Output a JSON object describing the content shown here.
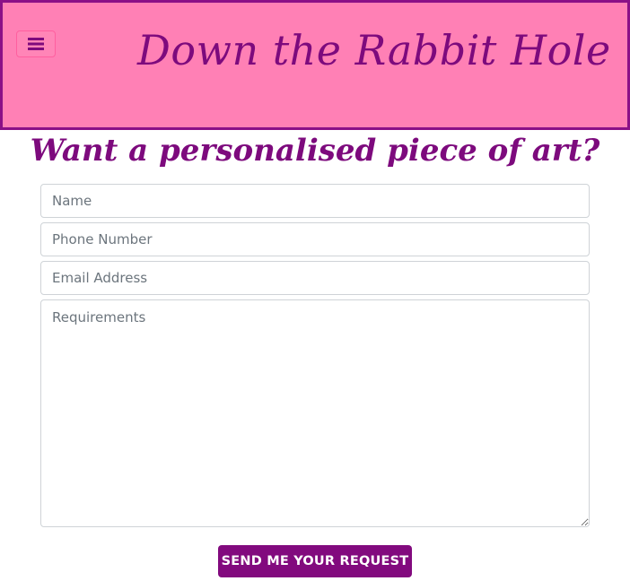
{
  "header": {
    "title": "Down the Rabbit Hole",
    "menu_icon": "hamburger-menu-icon"
  },
  "form": {
    "heading": "Want a personalised piece of art?",
    "name_placeholder": "Name",
    "phone_placeholder": "Phone Number",
    "email_placeholder": "Email Address",
    "requirements_placeholder": "Requirements",
    "submit_label": "SEND ME YOUR REQUEST"
  },
  "colors": {
    "header_background": "#ff80b5",
    "header_border": "#8b1087",
    "title_text": "#7d0a7d",
    "button_background": "#820a7e",
    "button_text": "#ffffff"
  }
}
